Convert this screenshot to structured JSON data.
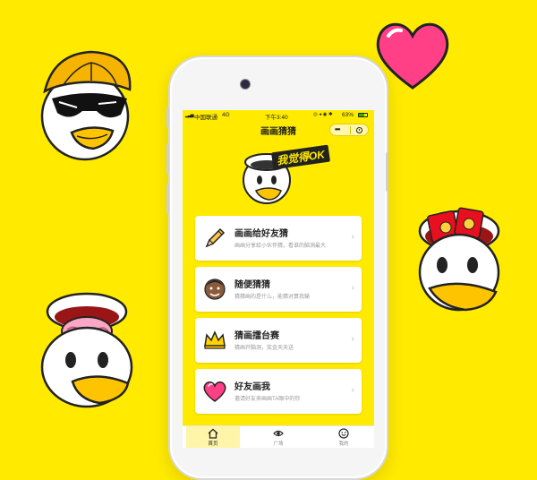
{
  "statusbar": {
    "carrier": "中国联通",
    "network": "4G",
    "time": "下午3:40",
    "battery": "63%"
  },
  "navbar": {
    "title": "画画猜猜",
    "more_label": "•••"
  },
  "banner": {
    "text": "我觉得OK"
  },
  "menu": [
    {
      "title": "画画给好友猜",
      "subtitle": "画画分享给小伙伴猜，看谁的脑洞最大",
      "icon": "pencil-icon"
    },
    {
      "title": "随便猜猜",
      "subtitle": "猜猜画的是什么，能猜对算我输",
      "icon": "face-emoji-icon"
    },
    {
      "title": "猜画擂台赛",
      "subtitle": "猜画开脑洞，奖金天天送",
      "icon": "crown-icon"
    },
    {
      "title": "好友画我",
      "subtitle": "邀请好友来画画TA眼中的你",
      "icon": "heart-icon"
    }
  ],
  "tabs": [
    {
      "label": "首页",
      "icon": "home-icon",
      "active": true
    },
    {
      "label": "广场",
      "icon": "eye-icon",
      "active": false
    },
    {
      "label": "我的",
      "icon": "smiley-icon",
      "active": false
    }
  ],
  "colors": {
    "background": "#FFEA00",
    "heart": "#FF3F86",
    "card": "#FFFFFF"
  }
}
